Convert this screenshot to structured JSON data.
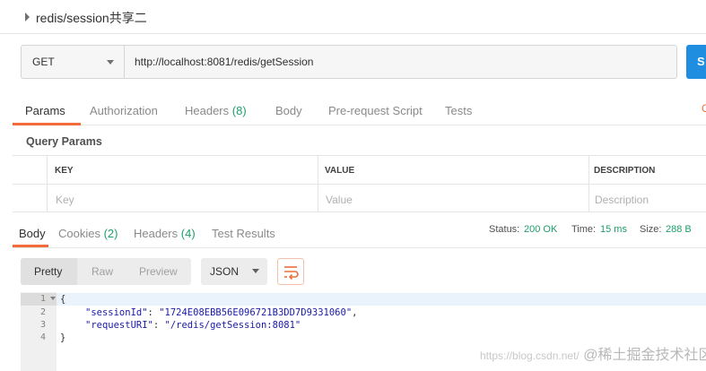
{
  "request": {
    "name": "redis/session共享二",
    "method": "GET",
    "url": "http://localhost:8081/redis/getSession",
    "send_label": "S"
  },
  "request_tabs": {
    "params": "Params",
    "authorization": "Authorization",
    "headers": "Headers",
    "headers_count": "(8)",
    "body": "Body",
    "pre_request": "Pre-request Script",
    "tests": "Tests",
    "right_fragment": "C"
  },
  "query_params": {
    "title": "Query Params",
    "columns": [
      "KEY",
      "VALUE",
      "DESCRIPTION"
    ],
    "placeholders": [
      "Key",
      "Value",
      "Description"
    ]
  },
  "response_tabs": {
    "body": "Body",
    "cookies": "Cookies",
    "cookies_count": "(2)",
    "headers": "Headers",
    "headers_count": "(4)",
    "test_results": "Test Results"
  },
  "response_status": {
    "status_label": "Status:",
    "status_value": "200 OK",
    "time_label": "Time:",
    "time_value": "15 ms",
    "size_label": "Size:",
    "size_value": "288 B"
  },
  "response_toolbar": {
    "pretty": "Pretty",
    "raw": "Raw",
    "preview": "Preview",
    "format": "JSON"
  },
  "response_body": {
    "line_numbers": [
      "1",
      "2",
      "3",
      "4"
    ],
    "line1": "{",
    "session_key": "\"sessionId\"",
    "session_value": "\"1724E08EBB56E096721B3DD7D9331060\"",
    "uri_key": "\"requestURI\"",
    "uri_value": "\"/redis/getSession:8081\"",
    "line4": "}"
  },
  "watermark": {
    "faint": "https://blog.csdn.net/",
    "brand": "@稀土掘金技术社区"
  },
  "colors": {
    "accent_orange": "#f26b3a",
    "count_green": "#1e9e6a",
    "send_blue": "#1f8ee0"
  }
}
